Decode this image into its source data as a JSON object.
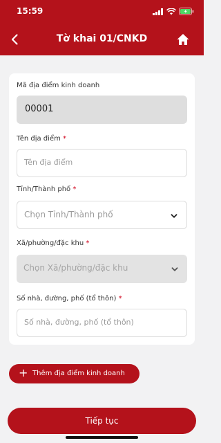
{
  "status": {
    "time": "15:59"
  },
  "header": {
    "title": "Tờ khai 01/CNKD"
  },
  "form": {
    "code_label": "Mã địa điểm kinh doanh",
    "code_value": "00001",
    "name_label": "Tên địa điểm",
    "name_placeholder": "Tên địa điểm",
    "province_label": "Tỉnh/Thành phố",
    "province_placeholder": "Chọn Tỉnh/Thành phố",
    "ward_label": "Xã/phường/đặc khu",
    "ward_placeholder": "Chọn Xã/phường/đặc khu",
    "street_label": "Số nhà, đường, phố (tổ thôn)",
    "street_placeholder": "Số nhà, đường, phố (tổ thôn)",
    "required_mark": "*"
  },
  "actions": {
    "add_plus": "+",
    "add_location_label": "Thêm địa điểm kinh doanh",
    "next_label": "Tiếp tục"
  },
  "colors": {
    "brand": "#b4121b",
    "required": "#d0021b"
  },
  "icons": [
    "signal-icon",
    "wifi-icon",
    "battery-icon",
    "back-icon",
    "home-icon",
    "chevron-down-icon"
  ]
}
